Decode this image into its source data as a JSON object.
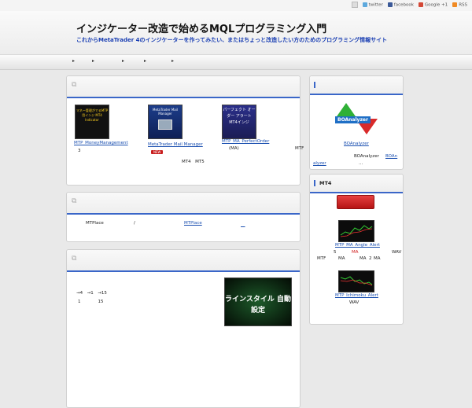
{
  "topbar": {
    "links": [
      {
        "label": "twitter",
        "icon": "twitter-icon",
        "color": "#5ea9dd"
      },
      {
        "label": "facebook",
        "icon": "facebook-icon",
        "color": "#3b5998"
      },
      {
        "label": "Google +1",
        "icon": "google-plus-icon",
        "color": "#d34836"
      },
      {
        "label": "RSS",
        "icon": "rss-icon",
        "color": "#f08a24"
      }
    ]
  },
  "header": {
    "title": "インジケーター改造で始めるMQLプログラミング入門",
    "description": "これからMetaTrader 4のインジケーターを作ってみたい、またはちょっと改造したい方のためのプログラミング情報サイト"
  },
  "nav": {
    "items": [
      {
        "label": "▸"
      },
      {
        "label": "▸"
      },
      {
        "label": "▸"
      },
      {
        "label": "▸"
      },
      {
        "label": "▸"
      }
    ]
  },
  "box1": {
    "items": [
      {
        "link": "MTP_MoneyManagement",
        "note": "3",
        "thumb_text": "マネー管理がでるMTP用インジ MT4 Indicator"
      },
      {
        "link": "MetaTrader Mail Manager",
        "badge": "NEW",
        "thumb_text": "MetaTrader Mail Manager"
      },
      {
        "link": "MTP_MA_PerfectOrder",
        "note": "(MA)",
        "extra": "MTF",
        "thumb_text": "パーフェクト オーダー アラート MT4インジ"
      }
    ],
    "footer_text": "MT4　MT5"
  },
  "box2": {
    "text1": "MTPlace",
    "text2": "/",
    "link1": "MTPlace",
    "link2": "　"
  },
  "box3": {
    "line1": "→4　→1　→15",
    "line2": "1　　　　15",
    "thumb_text": "ラインスタイル 自動設定"
  },
  "sidebar": {
    "box1": {
      "logo_text": "BOAnalyzer",
      "link": "BOAnalyzer",
      "text": "BOAnalyzer",
      "link2": "BOAn",
      "link3": "alyzer",
      "dots": "..."
    },
    "box2": {
      "title": "MT4",
      "item1": {
        "link": "MTP_MA_Angle_Alert",
        "line1a": "5",
        "line1b": "MA",
        "line1c": "WAV",
        "line2a": "MTF",
        "line2b": "MA",
        "line2c": "MA",
        "line2d": "2",
        "line2e": "MA"
      },
      "item2": {
        "link": "MTP_Ichimoku_Alert",
        "line1": "WAV"
      }
    }
  }
}
